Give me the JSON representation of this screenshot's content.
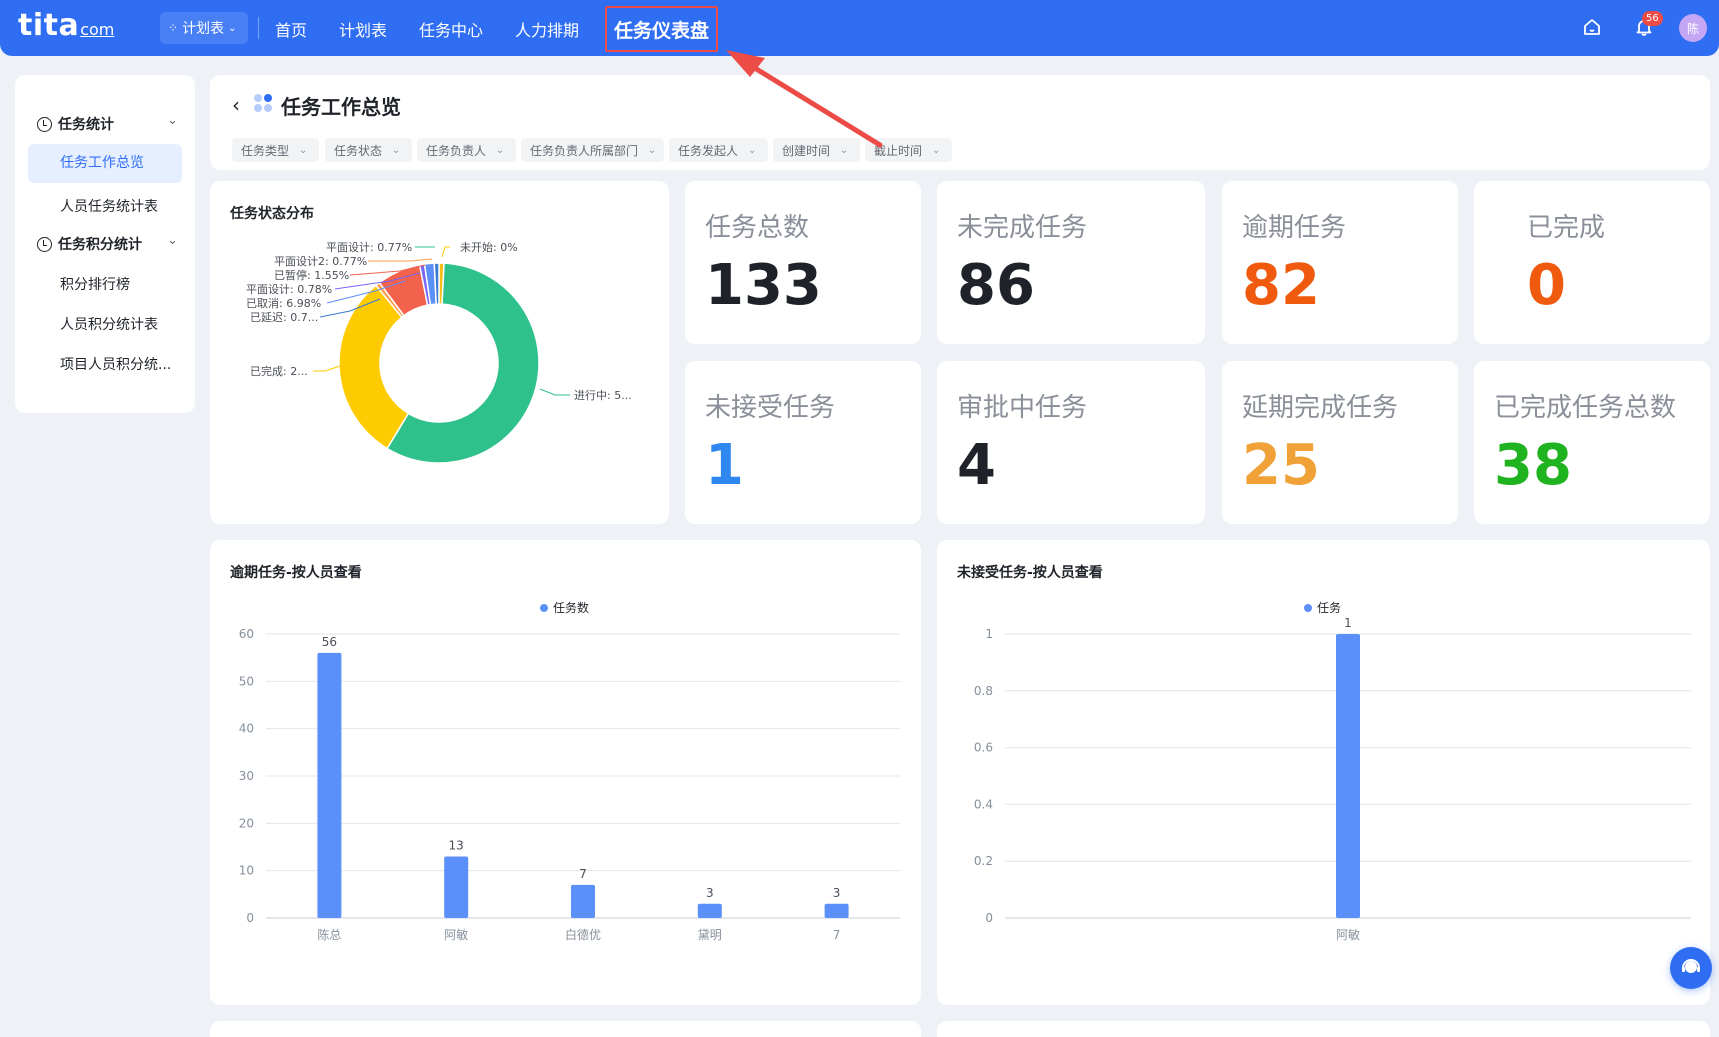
{
  "topbar": {
    "logo_main": "tita",
    "logo_suffix": "com",
    "app_switch": "计划表",
    "nav": [
      "首页",
      "计划表",
      "任务中心",
      "人力排期"
    ],
    "nav_active": "任务仪表盘",
    "notification_count": "56",
    "avatar_text": "陈"
  },
  "sidebar": {
    "group1": "任务统计",
    "group1_items": [
      "任务工作总览",
      "人员任务统计表"
    ],
    "group2": "任务积分统计",
    "group2_items": [
      "积分排行榜",
      "人员积分统计表",
      "项目人员积分统..."
    ]
  },
  "header": {
    "title": "任务工作总览",
    "filters": [
      "任务类型",
      "任务状态",
      "任务负责人",
      "任务负责人所属部门",
      "任务发起人",
      "创建时间",
      "截止时间"
    ]
  },
  "donut": {
    "title": "任务状态分布",
    "labels": [
      "平面设计: 0.77%",
      "未开始: 0%",
      "平面设计2: 0.77%",
      "已暂停: 1.55%",
      "平面设计: 0.78%",
      "已取消: 6.98%",
      "已延迟: 0.7...",
      "已完成: 2...",
      "进行中: 5..."
    ]
  },
  "stats": [
    {
      "label": "任务总数",
      "value": "133"
    },
    {
      "label": "未完成任务",
      "value": "86"
    },
    {
      "label": "逾期任务",
      "value": "82"
    },
    {
      "label": "已完成",
      "value": "0"
    },
    {
      "label": "未接受任务",
      "value": "1"
    },
    {
      "label": "审批中任务",
      "value": "4"
    },
    {
      "label": "延期完成任务",
      "value": "25"
    },
    {
      "label": "已完成任务总数",
      "value": "38"
    }
  ],
  "colors": {
    "brand": "#2f6ef3",
    "orange": "#f05a0e",
    "blue": "#2f88f0",
    "amber": "#f0a138",
    "green": "#1fb31f",
    "bar": "#5b8ff9",
    "donut_green": "#2ec18b",
    "donut_yellow": "#fecb00",
    "donut_red": "#f2624d"
  },
  "chart_data": [
    {
      "type": "pie",
      "title": "任务状态分布",
      "categories": [
        "进行中",
        "已完成",
        "已延迟",
        "已取消",
        "平面设计",
        "已暂停",
        "平面设计2",
        "平面设计",
        "未开始"
      ],
      "values": [
        57.4,
        30.2,
        0.7,
        6.98,
        0.78,
        1.55,
        0.77,
        0.77,
        0
      ]
    },
    {
      "type": "bar",
      "title": "逾期任务-按人员查看",
      "legend": "任务数",
      "categories": [
        "陈总",
        "阿敏",
        "白德优",
        "黛明",
        "7"
      ],
      "values": [
        56,
        13,
        7,
        3,
        3
      ],
      "ylim": [
        0,
        60
      ],
      "yticks": [
        "60",
        "50",
        "40",
        "30",
        "20",
        "10",
        "0"
      ]
    },
    {
      "type": "bar",
      "title": "未接受任务-按人员查看",
      "legend": "任务",
      "categories": [
        "阿敏"
      ],
      "values": [
        1
      ],
      "ylim": [
        0,
        1
      ],
      "yticks": [
        "1",
        "0.8",
        "0.6",
        "0.4",
        "0.2",
        "0"
      ]
    }
  ]
}
